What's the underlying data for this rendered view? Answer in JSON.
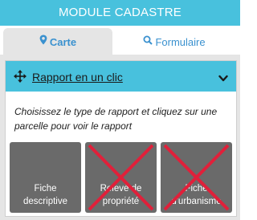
{
  "header": {
    "title": "MODULE CADASTRE"
  },
  "tabs": [
    {
      "label": "Carte",
      "icon": "map-marker-icon",
      "active": true
    },
    {
      "label": "Formulaire",
      "icon": "search-icon",
      "active": false
    }
  ],
  "accordion": {
    "title": "Rapport en un clic",
    "icon": "move-icon",
    "toggle_icon": "chevron-down-icon",
    "instructions": "Choisissez le type de rapport et cliquez sur une parcelle pour voir le rapport"
  },
  "reports": [
    {
      "line1": "Fiche",
      "line2": "descriptive",
      "disabled": false
    },
    {
      "line1": "Relevé de",
      "line2": "propriété",
      "disabled": true
    },
    {
      "line1": "Fiche",
      "line2": "d'urbanisme",
      "disabled": true
    }
  ],
  "colors": {
    "accent": "#48c1dd",
    "tab_text": "#3a91cf",
    "card_bg": "#6a6a6a",
    "disabled_cross": "#e0203a"
  }
}
